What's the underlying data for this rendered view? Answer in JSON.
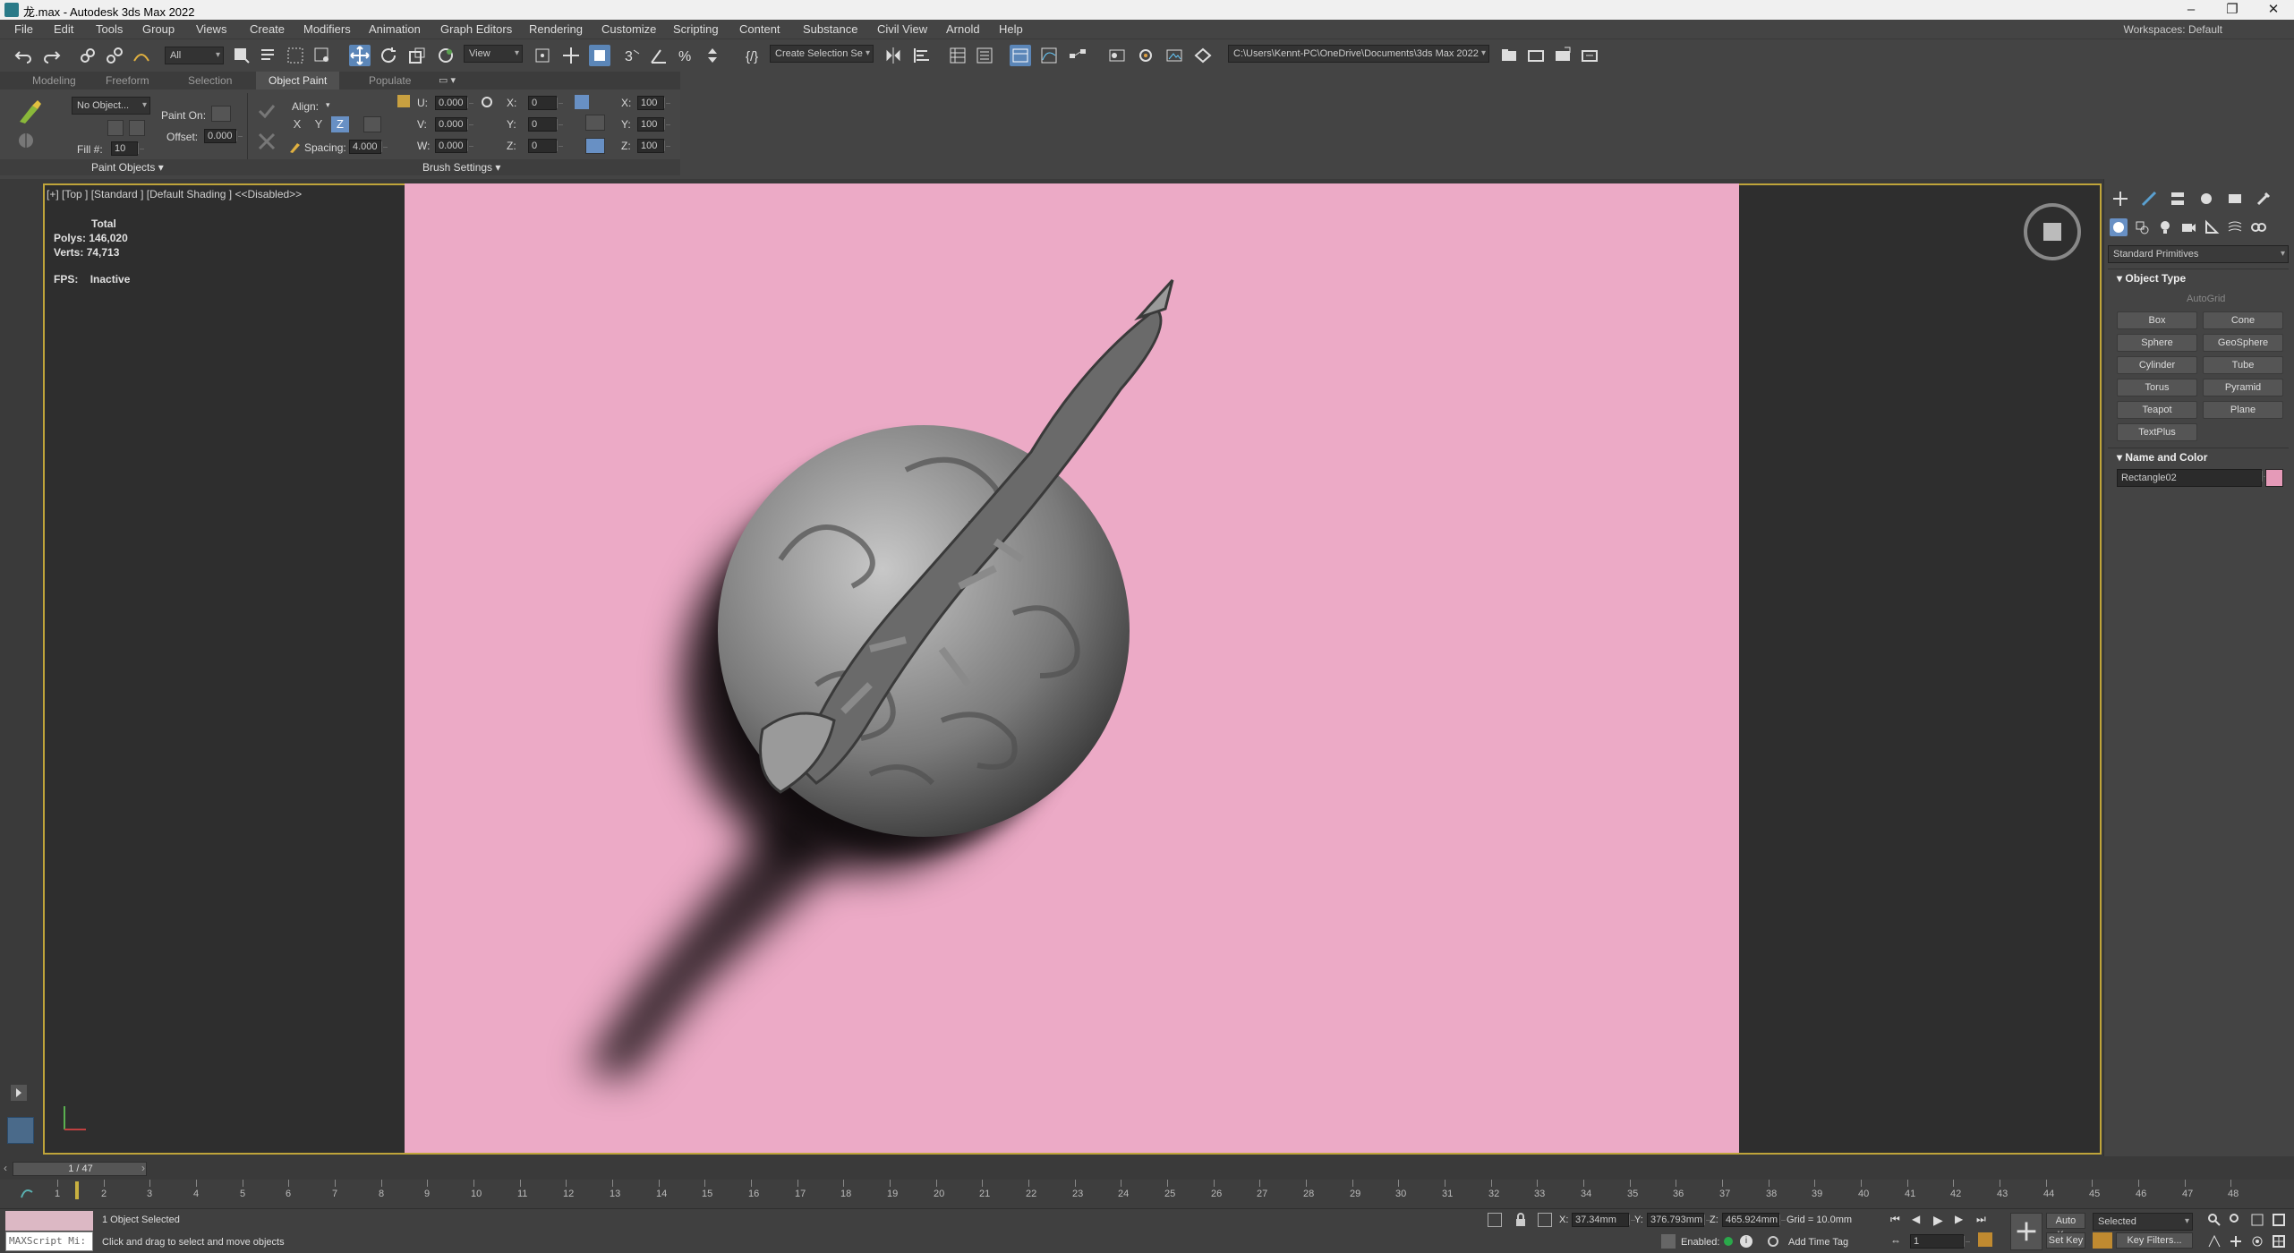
{
  "title": "龙.max - Autodesk 3ds Max 2022",
  "window_buttons": [
    "–",
    "❐",
    "✕"
  ],
  "menu": [
    "File",
    "Edit",
    "Tools",
    "Group",
    "Views",
    "Create",
    "Modifiers",
    "Animation",
    "Graph Editors",
    "Rendering",
    "Customize",
    "Scripting",
    "Content",
    "Substance",
    "Civil View",
    "Arnold",
    "Help"
  ],
  "workspace": "Workspaces:  Default",
  "toolbar": {
    "selection_filter": "All",
    "ref_coord": "View",
    "named_selection": "Create Selection Se",
    "project_path": "C:\\Users\\Kennt-PC\\OneDrive\\Documents\\3ds Max 2022"
  },
  "ribbon_tabs": [
    "Modeling",
    "Freeform",
    "Selection",
    "Object Paint",
    "Populate"
  ],
  "ribbon": {
    "no_object": "No Object...",
    "paint_on": "Paint On:",
    "offset_label": "Offset:",
    "offset_value": "0.000",
    "fill_label": "Fill #:",
    "fill_value": "10",
    "align": "Align:",
    "axes": [
      "X",
      "Y",
      "Z"
    ],
    "spacing_label": "Spacing:",
    "spacing_value": "4.000",
    "uvw_labels": [
      "U:",
      "V:",
      "W:"
    ],
    "uvw_values": [
      "0.000",
      "0.000",
      "0.000"
    ],
    "xyz_rot_labels": [
      "X:",
      "Y:",
      "Z:"
    ],
    "xyz_rot_values": [
      "0",
      "0",
      "0"
    ],
    "xyz_scale_labels": [
      "X:",
      "Y:",
      "Z:"
    ],
    "xyz_scale_values": [
      "100",
      "100",
      "100"
    ],
    "group_paint_objects": "Paint Objects ▾",
    "group_brush_settings": "Brush Settings ▾"
  },
  "viewport": {
    "label": "[+] [Top ] [Standard ] [Default Shading ]  <<Disabled>>",
    "stats_header": "Total",
    "polys_label": "Polys:",
    "polys_value": "146,020",
    "verts_label": "Verts:",
    "verts_value": "74,713",
    "fps_label": "FPS:",
    "fps_value": "Inactive",
    "background_color": "#ecaac6"
  },
  "command_panel": {
    "category": "Standard Primitives",
    "object_type_header": "Object Type",
    "autogrid": "AutoGrid",
    "buttons": [
      "Box",
      "Cone",
      "Sphere",
      "GeoSphere",
      "Cylinder",
      "Tube",
      "Torus",
      "Pyramid",
      "Teapot",
      "Plane",
      "TextPlus"
    ],
    "name_color_header": "Name and Color",
    "object_name": "Rectangle02",
    "object_color": "#e59ab8"
  },
  "timeline": {
    "frame_display": "1 / 47",
    "ticks": [
      "1",
      "2",
      "3",
      "4",
      "5",
      "6",
      "7",
      "8",
      "9",
      "10",
      "11",
      "12",
      "13",
      "14",
      "15",
      "16",
      "17",
      "18",
      "19",
      "20",
      "21",
      "22",
      "23",
      "24",
      "25",
      "26",
      "27",
      "28",
      "29",
      "30",
      "31",
      "32",
      "33",
      "34",
      "35",
      "36",
      "37",
      "38",
      "39",
      "40",
      "41",
      "42",
      "43",
      "44",
      "45",
      "46",
      "47",
      "48"
    ]
  },
  "status": {
    "maxscript": "MAXScript Mi:",
    "selected_count": "1 Object Selected",
    "prompt": "Click and drag to select and move objects",
    "x_label": "X:",
    "x_value": "37.34mm",
    "y_label": "Y:",
    "y_value": "376.793mm",
    "z_label": "Z:",
    "z_value": "465.924mm",
    "grid": "Grid = 10.0mm",
    "enabled_label": "Enabled:",
    "add_time_tag": "Add Time Tag",
    "frame_value": "1",
    "auto_key": "Auto Key",
    "selected_set": "Selected",
    "set_key": "Set Key",
    "key_filters": "Key Filters..."
  }
}
